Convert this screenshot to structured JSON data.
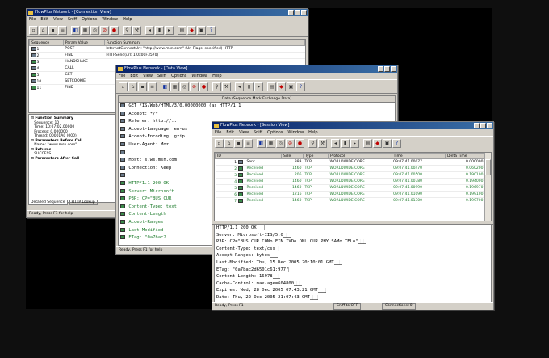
{
  "menu": [
    "File",
    "Edit",
    "View",
    "Sniff",
    "Options",
    "Window",
    "Help"
  ],
  "win1": {
    "title": "FlowPlus Network - [Connection View]",
    "columns": [
      "Sequence",
      "Param Value",
      "Function Summary"
    ],
    "rows": [
      {
        "seq": "1",
        "v": "POST",
        "s": "InternetConnectUrl: \"http://www.msn.com\" (Url Flags: specified) HTTP"
      },
      {
        "seq": "2",
        "v": "FIND",
        "s": "HTTPSend(url: 1 0x00F3570)"
      },
      {
        "seq": "3",
        "v": "HANDSHAKE",
        "s": ""
      },
      {
        "seq": "4",
        "v": "CALL",
        "s": ""
      },
      {
        "seq": "5",
        "v": "GET",
        "s": ""
      },
      {
        "seq": "10",
        "v": "SETCOOKIE",
        "s": ""
      },
      {
        "seq": "11",
        "v": "FIND",
        "s": ""
      }
    ],
    "tree": [
      {
        "t": "Function Summary",
        "b": true
      },
      {
        "t": "Sequence: 10",
        "b": false
      },
      {
        "t": "Time: 10:07:02.00000",
        "b": false
      },
      {
        "t": "Process: 0.000000",
        "b": false
      },
      {
        "t": "Thread: 00001A0 (000)",
        "b": false
      },
      {
        "t": "Parameters Before Call",
        "b": true
      },
      {
        "t": "Name: \"www.msn.com\"",
        "b": false
      },
      {
        "t": "Returns",
        "b": true
      },
      {
        "t": "SUCCESS",
        "b": false
      },
      {
        "t": "Parameters After Call",
        "b": true
      }
    ],
    "tabs": [
      "Detailed Sequence",
      "HTTP Lookup"
    ],
    "status": "Ready, Press F1 for help"
  },
  "win2": {
    "title": "FlowPlus Network - [Data View]",
    "header": "Data (Sequence Mark Exchange Data)",
    "lines": [
      {
        "t": "GET /IS/Web/HTML/3/0.00000000 (as HTTP/1.1",
        "k": "req"
      },
      {
        "t": "Accept: */*",
        "k": "req"
      },
      {
        "t": "Referer: http://...",
        "k": "req"
      },
      {
        "t": "Accept-Language: en-us",
        "k": "req"
      },
      {
        "t": "Accept-Encoding: gzip",
        "k": "req"
      },
      {
        "t": "User-Agent: Moz...",
        "k": "req"
      },
      {
        "t": "",
        "k": "req"
      },
      {
        "t": "Host: s.ws.msn.com",
        "k": "req"
      },
      {
        "t": "Connection: Keep",
        "k": "req"
      },
      {
        "t": "",
        "k": "req"
      },
      {
        "t": "HTTP/1.1 200 OK",
        "k": "resp"
      },
      {
        "t": "Server: Microsoft",
        "k": "resp"
      },
      {
        "t": "P3P: CP=\"BUS CUR",
        "k": "resp"
      },
      {
        "t": "Content-Type: text",
        "k": "resp"
      },
      {
        "t": "Content-Length",
        "k": "resp"
      },
      {
        "t": "Accept-Ranges",
        "k": "resp"
      },
      {
        "t": "Last-Modified",
        "k": "resp"
      },
      {
        "t": "ETag: \"0a7bac2",
        "k": "resp"
      }
    ],
    "status": "Ready, Press F1 for help"
  },
  "win3": {
    "title": "FlowPlus Network - [Session View]",
    "columns": [
      "ID",
      "",
      "Size",
      "Type",
      "Protocol",
      "Time",
      "Delta Time"
    ],
    "rows": [
      {
        "id": "1",
        "n": "Sent",
        "size": "383",
        "type": "TCP",
        "proto": "WORLDWIDE CORE",
        "time": "09:07:41.00077",
        "d": "0.000000"
      },
      {
        "id": "2",
        "n": "Received",
        "size": "1460",
        "type": "TCP",
        "proto": "WORLDWIDE CORE",
        "time": "09:07:41.00470",
        "d": "0.060200"
      },
      {
        "id": "3",
        "n": "Received",
        "size": "206",
        "type": "TCP",
        "proto": "WORLDWIDE CORE",
        "time": "09:07:41.00500",
        "d": "0.190100"
      },
      {
        "id": "4",
        "n": "Received",
        "size": "1460",
        "type": "TCP",
        "proto": "WORLDWIDE CORE",
        "time": "09:07:41.00780",
        "d": "0.194000"
      },
      {
        "id": "5",
        "n": "Received",
        "size": "1460",
        "type": "TCP",
        "proto": "WORLDWIDE CORE",
        "time": "09:07:41.00990",
        "d": "0.196970"
      },
      {
        "id": "6",
        "n": "Received",
        "size": "1216",
        "type": "TCP",
        "proto": "WORLDWIDE CORE",
        "time": "09:07:41.01090",
        "d": "0.199100"
      },
      {
        "id": "7",
        "n": "Received",
        "size": "1460",
        "type": "TCP",
        "proto": "WORLDWIDE CORE",
        "time": "09:07:41.01300",
        "d": "0.199700"
      }
    ],
    "raw": [
      {
        "t": "HTTP/1.1 200 OK",
        "h": "███"
      },
      {
        "t": "Server: Microsoft-IIS/5.0",
        "h": "███"
      },
      {
        "t": "P3P: CP=\"BUS CUR CONo FIN IVDo ONL OUR PHY SAMo TELo\"",
        "h": "███"
      },
      {
        "t": "Content-Type: text/css",
        "h": "███"
      },
      {
        "t": "Accept-Ranges: bytes",
        "h": "███"
      },
      {
        "t": "Last-Modified: Thu, 15 Dec 2005 20:10:01 GMT",
        "h": "███"
      },
      {
        "t": "ETag: \"0a7bac2d6501c61:977\"",
        "h": "███"
      },
      {
        "t": "Content-Length: 16978",
        "h": "███"
      },
      {
        "t": "Cache-Control: max-age=604800",
        "h": "███"
      },
      {
        "t": "Expires: Wed, 28 Dec 2005 07:43:21 GMT",
        "h": "███"
      },
      {
        "t": "Date: Thu, 22 Dec 2005 21:07:43 GMT",
        "h": "███"
      }
    ],
    "status": "Ready, Press F1",
    "status2": "Sniff to OFF",
    "status3": "Connections: 0"
  }
}
